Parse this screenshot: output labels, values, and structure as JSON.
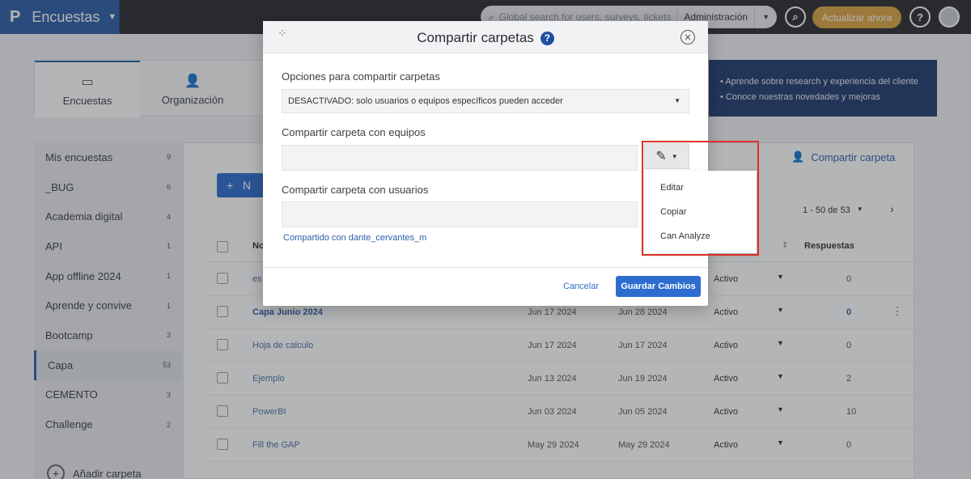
{
  "app": {
    "logo": "P",
    "module": "Encuestas"
  },
  "topbar": {
    "search_placeholder": "Global search for users, surveys, tickets",
    "scope": "Administración",
    "upgrade_label": "Actualizar ahora"
  },
  "tabs": [
    {
      "label": "Encuestas"
    },
    {
      "label": "Organización"
    }
  ],
  "banner": {
    "items": [
      "Aprende sobre research y experiencia del cliente",
      "Conoce nuestras novedades y mejoras"
    ]
  },
  "sidebar": {
    "folders": [
      {
        "label": "Mis encuestas",
        "count": "9"
      },
      {
        "label": "_BUG",
        "count": "6"
      },
      {
        "label": "Academia digital",
        "count": "4"
      },
      {
        "label": "API",
        "count": "1"
      },
      {
        "label": "App offline 2024",
        "count": "1"
      },
      {
        "label": "Aprende y convive",
        "count": "1"
      },
      {
        "label": "Bootcamp",
        "count": "3"
      },
      {
        "label": "Capa",
        "count": "53"
      },
      {
        "label": "CEMENTO",
        "count": "3"
      },
      {
        "label": "Challenge",
        "count": "2"
      }
    ],
    "add_folder": "Añadir carpeta"
  },
  "main": {
    "share_folder": "Compartir carpeta",
    "new_label": "N",
    "pager": "1 - 50 de 53",
    "columns": {
      "name": "No",
      "responses": "Respuestas"
    },
    "rows": [
      {
        "name": "es",
        "d1": "",
        "d2": "",
        "status": "Activo",
        "responses": "0"
      },
      {
        "name": "Capa Junio 2024",
        "d1": "Jun 17 2024",
        "d2": "Jun 28 2024",
        "status": "Activo",
        "responses": "0"
      },
      {
        "name": "Hoja de calculo",
        "d1": "Jun 17 2024",
        "d2": "Jun 17 2024",
        "status": "Activo",
        "responses": "0"
      },
      {
        "name": "Ejemplo",
        "d1": "Jun 13 2024",
        "d2": "Jun 19 2024",
        "status": "Activo",
        "responses": "2"
      },
      {
        "name": "PowerBI",
        "d1": "Jun 03 2024",
        "d2": "Jun 05 2024",
        "status": "Activo",
        "responses": "10"
      },
      {
        "name": "Fill the GAP",
        "d1": "May 29 2024",
        "d2": "May 29 2024",
        "status": "Activo",
        "responses": "0"
      }
    ]
  },
  "modal": {
    "title": "Compartir carpetas",
    "options_label": "Opciones para compartir carpetas",
    "options_value": "DESACTIVADO: solo usuarios o equipos específicos pueden acceder",
    "teams_label": "Compartir carpeta con equipos",
    "users_label": "Compartir carpeta con usuarios",
    "shared_with": "Compartido con dante_cervantes_m",
    "cancel": "Cancelar",
    "save": "Guardar Cambios"
  },
  "permission_menu": {
    "options": [
      "Editar",
      "Copiar",
      "Can Analyze"
    ]
  }
}
